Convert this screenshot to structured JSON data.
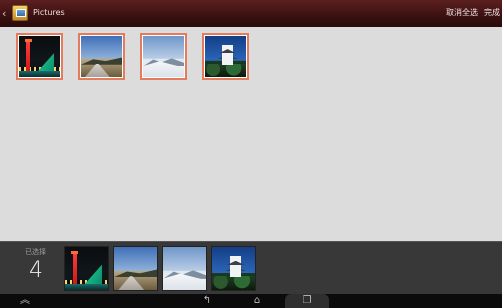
{
  "header": {
    "title": "Pictures",
    "cancel_label": "取消全选",
    "done_label": "完成",
    "icon": "pictures-folder-icon"
  },
  "grid": {
    "items": [
      {
        "name": "night-harbor-photo",
        "art": "night"
      },
      {
        "name": "mountain-road-photo",
        "art": "road"
      },
      {
        "name": "snowy-mountain-photo",
        "art": "snow"
      },
      {
        "name": "castle-photo",
        "art": "castle"
      }
    ],
    "selection_border_color": "#e47b5d"
  },
  "tray": {
    "selected_label": "已选择",
    "selected_count": "4"
  },
  "navbar": {
    "icons": [
      "home-up-icon",
      "back-icon",
      "home-icon",
      "recent-apps-icon"
    ]
  }
}
